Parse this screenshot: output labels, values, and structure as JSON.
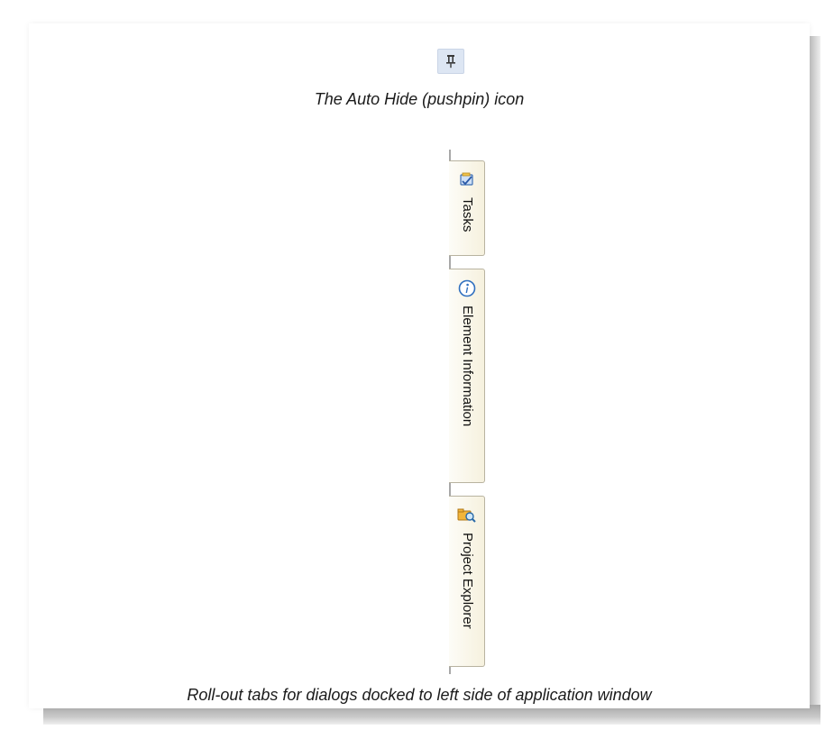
{
  "captions": {
    "top": "The Auto Hide (pushpin) icon",
    "bottom": "Roll-out tabs for dialogs docked to left side of application window"
  },
  "pin": {
    "icon": "pushpin-icon"
  },
  "tabs": [
    {
      "label": "Tasks",
      "icon": "tasks-icon"
    },
    {
      "label": "Element Information",
      "icon": "info-icon"
    },
    {
      "label": "Project Explorer",
      "icon": "project-explorer-icon"
    }
  ],
  "colors": {
    "tab_bg": "#f6f1de",
    "tab_border": "#b8b3a0",
    "pin_bg": "#dde6f3",
    "info_blue": "#2f6fbf"
  }
}
